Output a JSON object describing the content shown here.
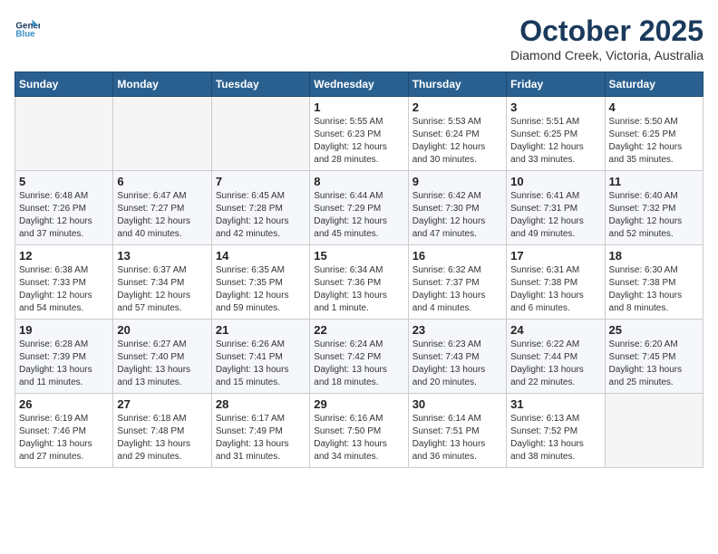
{
  "header": {
    "logo_line1": "General",
    "logo_line2": "Blue",
    "month": "October 2025",
    "location": "Diamond Creek, Victoria, Australia"
  },
  "days_of_week": [
    "Sunday",
    "Monday",
    "Tuesday",
    "Wednesday",
    "Thursday",
    "Friday",
    "Saturday"
  ],
  "weeks": [
    [
      {
        "num": "",
        "info": ""
      },
      {
        "num": "",
        "info": ""
      },
      {
        "num": "",
        "info": ""
      },
      {
        "num": "1",
        "info": "Sunrise: 5:55 AM\nSunset: 6:23 PM\nDaylight: 12 hours\nand 28 minutes."
      },
      {
        "num": "2",
        "info": "Sunrise: 5:53 AM\nSunset: 6:24 PM\nDaylight: 12 hours\nand 30 minutes."
      },
      {
        "num": "3",
        "info": "Sunrise: 5:51 AM\nSunset: 6:25 PM\nDaylight: 12 hours\nand 33 minutes."
      },
      {
        "num": "4",
        "info": "Sunrise: 5:50 AM\nSunset: 6:25 PM\nDaylight: 12 hours\nand 35 minutes."
      }
    ],
    [
      {
        "num": "5",
        "info": "Sunrise: 6:48 AM\nSunset: 7:26 PM\nDaylight: 12 hours\nand 37 minutes."
      },
      {
        "num": "6",
        "info": "Sunrise: 6:47 AM\nSunset: 7:27 PM\nDaylight: 12 hours\nand 40 minutes."
      },
      {
        "num": "7",
        "info": "Sunrise: 6:45 AM\nSunset: 7:28 PM\nDaylight: 12 hours\nand 42 minutes."
      },
      {
        "num": "8",
        "info": "Sunrise: 6:44 AM\nSunset: 7:29 PM\nDaylight: 12 hours\nand 45 minutes."
      },
      {
        "num": "9",
        "info": "Sunrise: 6:42 AM\nSunset: 7:30 PM\nDaylight: 12 hours\nand 47 minutes."
      },
      {
        "num": "10",
        "info": "Sunrise: 6:41 AM\nSunset: 7:31 PM\nDaylight: 12 hours\nand 49 minutes."
      },
      {
        "num": "11",
        "info": "Sunrise: 6:40 AM\nSunset: 7:32 PM\nDaylight: 12 hours\nand 52 minutes."
      }
    ],
    [
      {
        "num": "12",
        "info": "Sunrise: 6:38 AM\nSunset: 7:33 PM\nDaylight: 12 hours\nand 54 minutes."
      },
      {
        "num": "13",
        "info": "Sunrise: 6:37 AM\nSunset: 7:34 PM\nDaylight: 12 hours\nand 57 minutes."
      },
      {
        "num": "14",
        "info": "Sunrise: 6:35 AM\nSunset: 7:35 PM\nDaylight: 12 hours\nand 59 minutes."
      },
      {
        "num": "15",
        "info": "Sunrise: 6:34 AM\nSunset: 7:36 PM\nDaylight: 13 hours\nand 1 minute."
      },
      {
        "num": "16",
        "info": "Sunrise: 6:32 AM\nSunset: 7:37 PM\nDaylight: 13 hours\nand 4 minutes."
      },
      {
        "num": "17",
        "info": "Sunrise: 6:31 AM\nSunset: 7:38 PM\nDaylight: 13 hours\nand 6 minutes."
      },
      {
        "num": "18",
        "info": "Sunrise: 6:30 AM\nSunset: 7:38 PM\nDaylight: 13 hours\nand 8 minutes."
      }
    ],
    [
      {
        "num": "19",
        "info": "Sunrise: 6:28 AM\nSunset: 7:39 PM\nDaylight: 13 hours\nand 11 minutes."
      },
      {
        "num": "20",
        "info": "Sunrise: 6:27 AM\nSunset: 7:40 PM\nDaylight: 13 hours\nand 13 minutes."
      },
      {
        "num": "21",
        "info": "Sunrise: 6:26 AM\nSunset: 7:41 PM\nDaylight: 13 hours\nand 15 minutes."
      },
      {
        "num": "22",
        "info": "Sunrise: 6:24 AM\nSunset: 7:42 PM\nDaylight: 13 hours\nand 18 minutes."
      },
      {
        "num": "23",
        "info": "Sunrise: 6:23 AM\nSunset: 7:43 PM\nDaylight: 13 hours\nand 20 minutes."
      },
      {
        "num": "24",
        "info": "Sunrise: 6:22 AM\nSunset: 7:44 PM\nDaylight: 13 hours\nand 22 minutes."
      },
      {
        "num": "25",
        "info": "Sunrise: 6:20 AM\nSunset: 7:45 PM\nDaylight: 13 hours\nand 25 minutes."
      }
    ],
    [
      {
        "num": "26",
        "info": "Sunrise: 6:19 AM\nSunset: 7:46 PM\nDaylight: 13 hours\nand 27 minutes."
      },
      {
        "num": "27",
        "info": "Sunrise: 6:18 AM\nSunset: 7:48 PM\nDaylight: 13 hours\nand 29 minutes."
      },
      {
        "num": "28",
        "info": "Sunrise: 6:17 AM\nSunset: 7:49 PM\nDaylight: 13 hours\nand 31 minutes."
      },
      {
        "num": "29",
        "info": "Sunrise: 6:16 AM\nSunset: 7:50 PM\nDaylight: 13 hours\nand 34 minutes."
      },
      {
        "num": "30",
        "info": "Sunrise: 6:14 AM\nSunset: 7:51 PM\nDaylight: 13 hours\nand 36 minutes."
      },
      {
        "num": "31",
        "info": "Sunrise: 6:13 AM\nSunset: 7:52 PM\nDaylight: 13 hours\nand 38 minutes."
      },
      {
        "num": "",
        "info": ""
      }
    ]
  ]
}
